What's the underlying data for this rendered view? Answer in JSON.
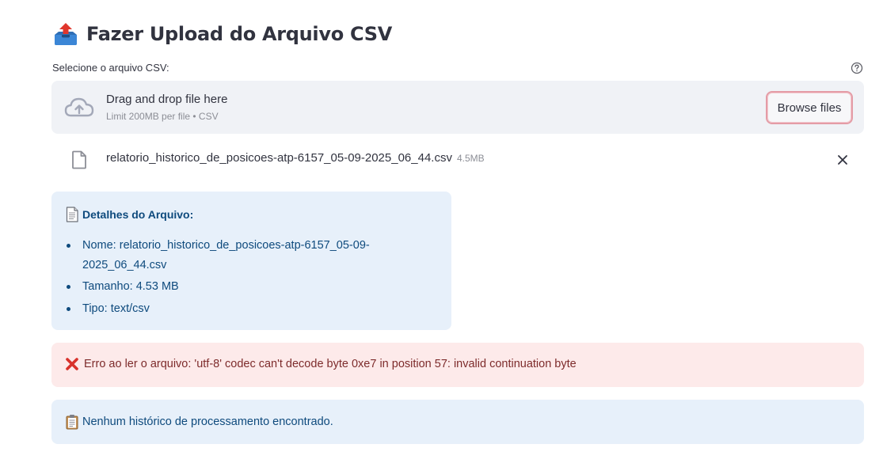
{
  "header": {
    "icon": "outbox-tray-icon",
    "title": "Fazer Upload do Arquivo CSV"
  },
  "uploader": {
    "label": "Selecione o arquivo CSV:",
    "help_icon": "question-circle-icon",
    "drop_text": "Drag and drop file here",
    "limit_text": "Limit 200MB per file • CSV",
    "browse_label": "Browse files",
    "cloud_icon": "cloud-upload-icon"
  },
  "uploaded_file": {
    "name": "relatorio_historico_de_posicoes-atp-6157_05-09-2025_06_44.csv",
    "size": "4.5MB",
    "file_icon": "file-icon",
    "remove_icon": "close-icon"
  },
  "details": {
    "icon": "page-facing-up-icon",
    "heading": "Detalhes do Arquivo:",
    "name_line1": "Nome: relatorio_historico_de_posicoes-atp-6157_05-09-",
    "name_line2": "2025_06_44.csv",
    "size_line": "Tamanho: 4.53 MB",
    "type_line": "Tipo: text/csv"
  },
  "error": {
    "icon": "cross-mark-icon",
    "message": "Erro ao ler o arquivo: 'utf-8' codec can't decode byte 0xe7 in position 57: invalid continuation byte"
  },
  "info": {
    "icon": "clipboard-icon",
    "message": "Nenhum histórico de processamento encontrado."
  },
  "colors": {
    "accent_button_border": "#e49ca6",
    "info_bg": "#e7f0fa",
    "info_text": "#0e4a7d",
    "error_bg": "#fdeaea",
    "error_text": "#7d2b2b",
    "dropzone_bg": "#f0f2f6"
  }
}
